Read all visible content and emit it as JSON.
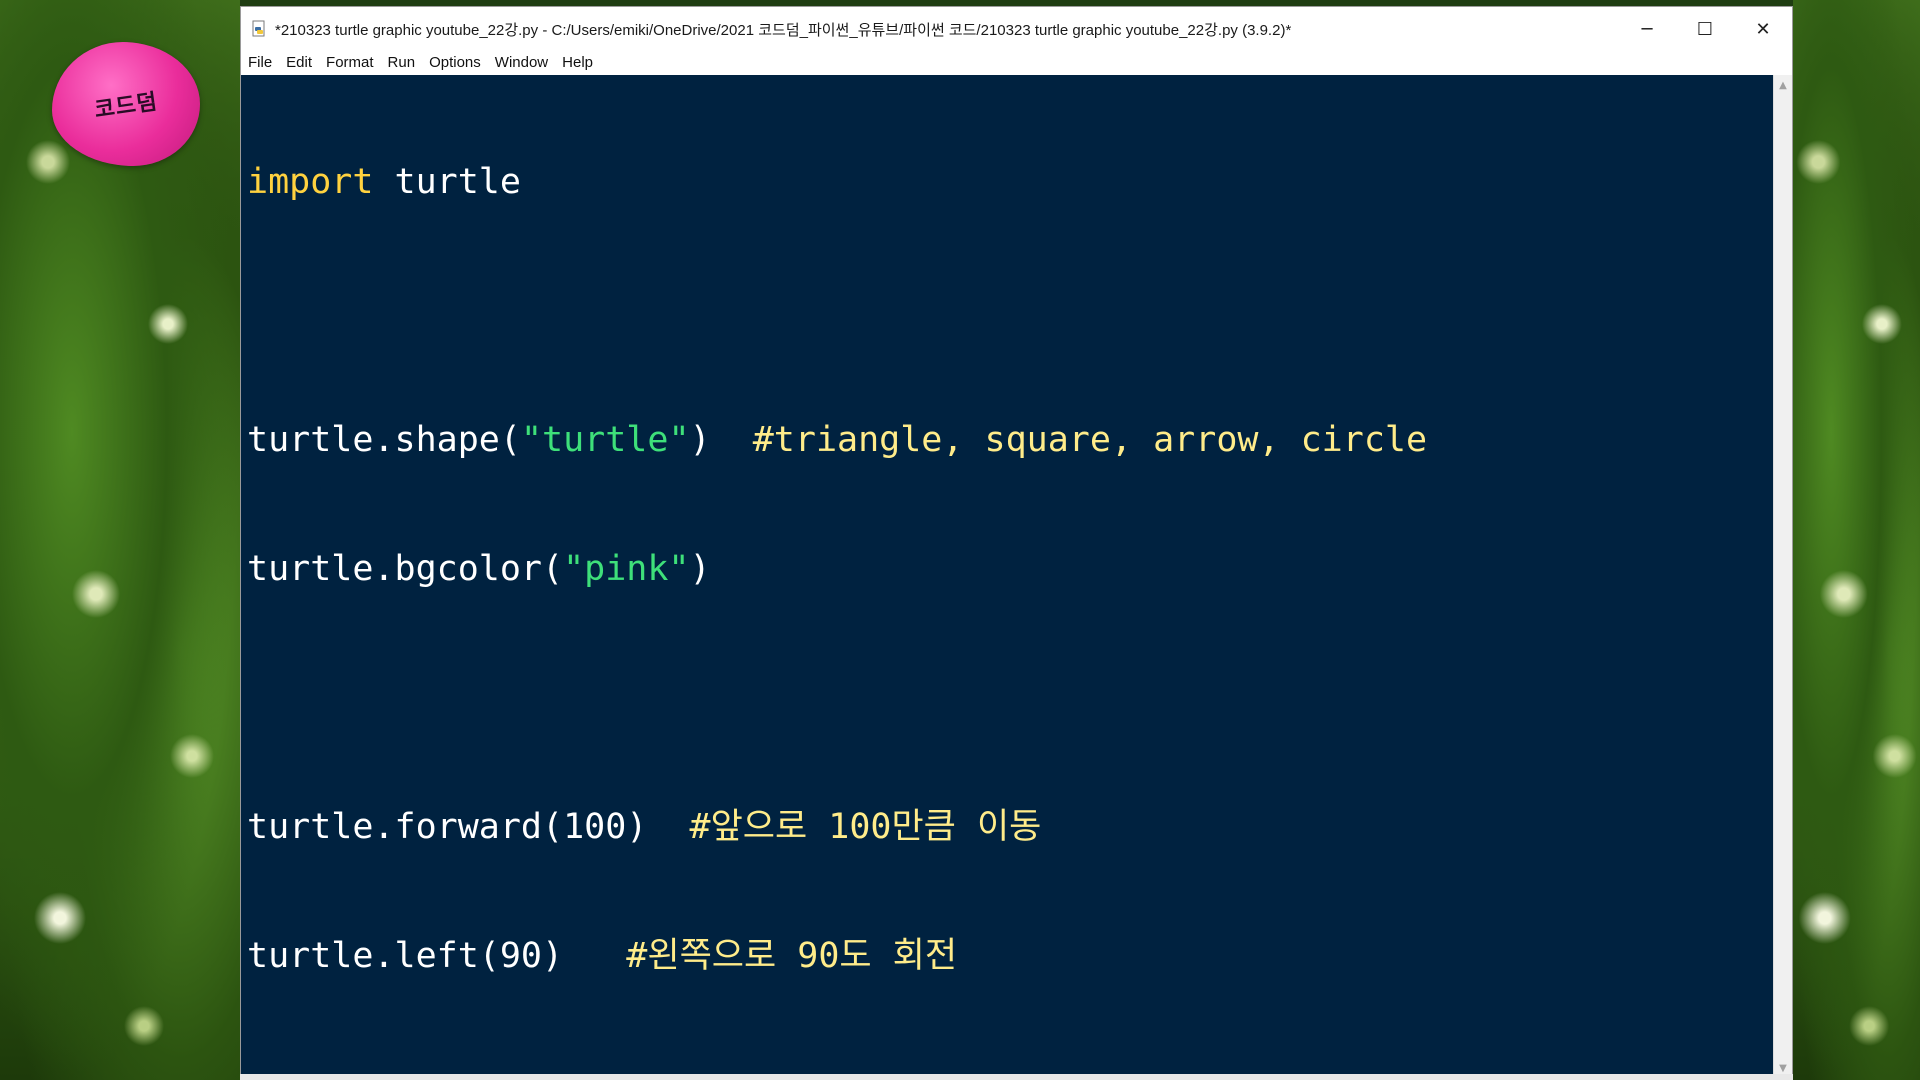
{
  "window": {
    "title": "*210323 turtle graphic youtube_22강.py - C:/Users/emiki/OneDrive/2021 코드덤_파이썬_유튜브/파이썬 코드/210323 turtle graphic youtube_22강.py (3.9.2)*",
    "icon": "python-file-icon",
    "controls": {
      "minimize": "─",
      "maximize": "☐",
      "close": "✕"
    }
  },
  "menu": {
    "file": "File",
    "edit": "Edit",
    "format": "Format",
    "run": "Run",
    "options": "Options",
    "window": "Window",
    "help": "Help"
  },
  "code": {
    "line1": {
      "keyword": "import",
      "rest": " turtle"
    },
    "line3": {
      "pre": "turtle.shape(",
      "string": "\"turtle\"",
      "post": ")  ",
      "comment": "#triangle, square, arrow, circle"
    },
    "line4": {
      "pre": "turtle.bgcolor(",
      "string": "\"pink\"",
      "post": ")"
    },
    "line6": {
      "pre": "turtle.forward(100)  ",
      "comment": "#앞으로 100만큼 이동"
    },
    "line7": {
      "pre": "turtle.left(90)   ",
      "comment": "#왼쪽으로 90도 회전"
    }
  },
  "colors": {
    "editor_bg": "#002240",
    "keyword": "#ffd23f",
    "string": "#3ee07a",
    "comment": "#ffec8a",
    "logo": "#ea2d9b"
  },
  "logo": {
    "text": "코드덤"
  }
}
